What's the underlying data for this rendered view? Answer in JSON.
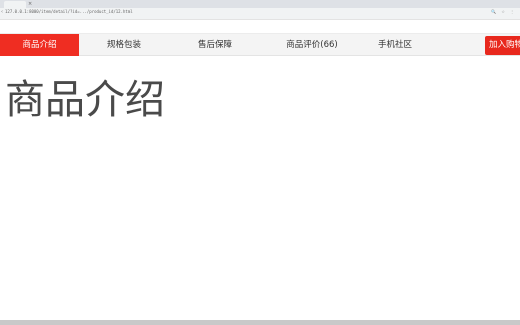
{
  "browser": {
    "tab_close": "×",
    "nav_arrow": "‹",
    "url": "127.0.0.1:8000/item/detail/?id=.../product_id/12.html",
    "chrome_icons": [
      "🔍",
      "☆",
      "⋮"
    ]
  },
  "tabs": [
    {
      "label": "商品介绍",
      "active": true
    },
    {
      "label": "规格包装",
      "active": false
    },
    {
      "label": "售后保障",
      "active": false
    },
    {
      "label": "商品评价(66)",
      "active": false
    },
    {
      "label": "手机社区",
      "active": false
    }
  ],
  "add_to_cart": "加入购物车",
  "section_heading": "商品介绍",
  "colors": {
    "accent": "#ef2d22",
    "tabbar_bg": "#f4f4f4",
    "heading": "#4a4a4a"
  }
}
